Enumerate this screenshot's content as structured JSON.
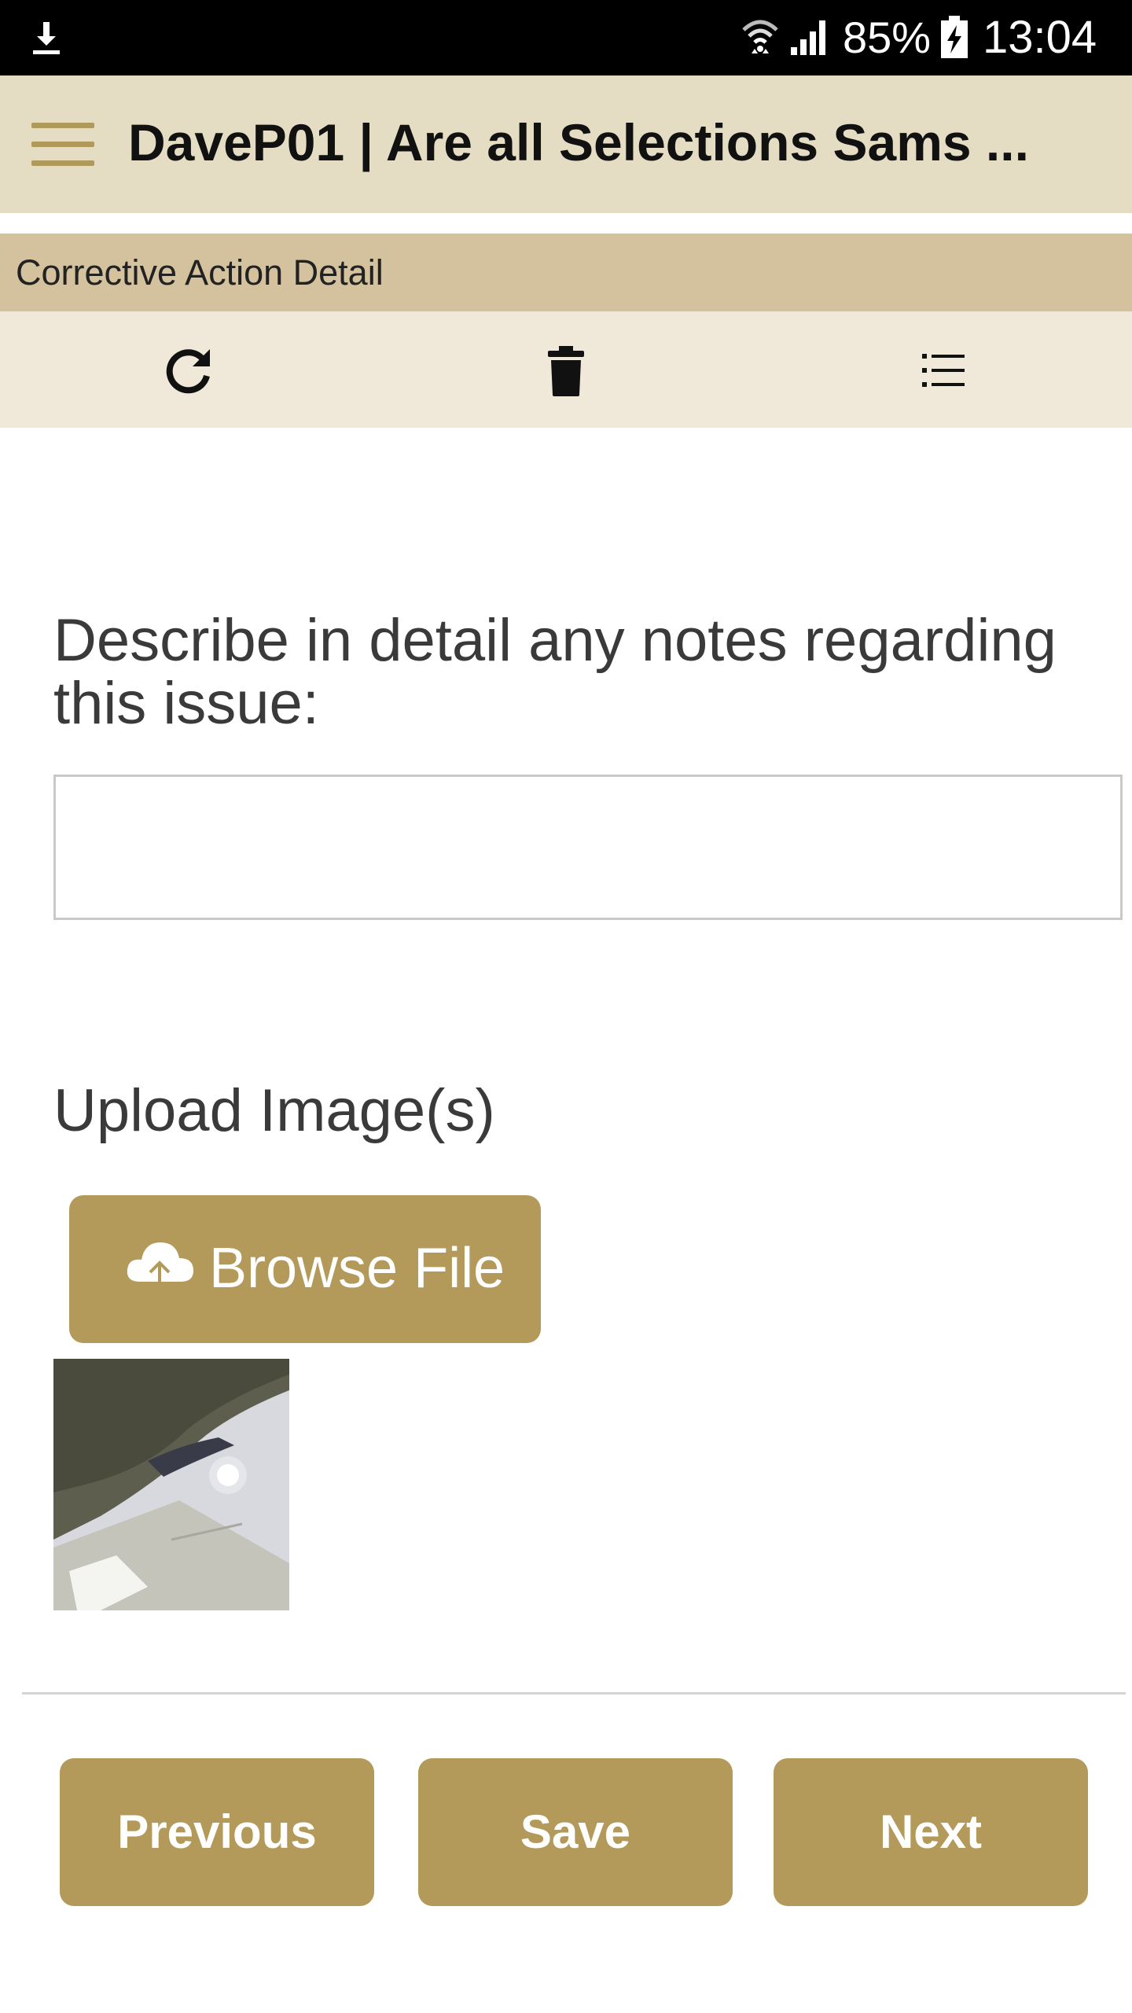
{
  "status_bar": {
    "battery_percent": "85%",
    "time": "13:04"
  },
  "app_bar": {
    "title": "DaveP01 | Are all Selections Sams ..."
  },
  "section_header": {
    "title": "Corrective Action Detail"
  },
  "toolbar": {
    "icons": [
      "refresh-icon",
      "trash-icon",
      "list-icon"
    ]
  },
  "form": {
    "question": "Describe in detail any notes regarding this issue:",
    "notes_value": "",
    "upload_label": "Upload Image(s)",
    "browse_label": "Browse File"
  },
  "footer": {
    "previous_label": "Previous",
    "save_label": "Save",
    "next_label": "Next"
  },
  "colors": {
    "app_bar_bg": "#e5dcc4",
    "section_header_bg": "#d3c29d",
    "toolbar_bg": "#f0e9da",
    "accent": "#b39a5a"
  }
}
